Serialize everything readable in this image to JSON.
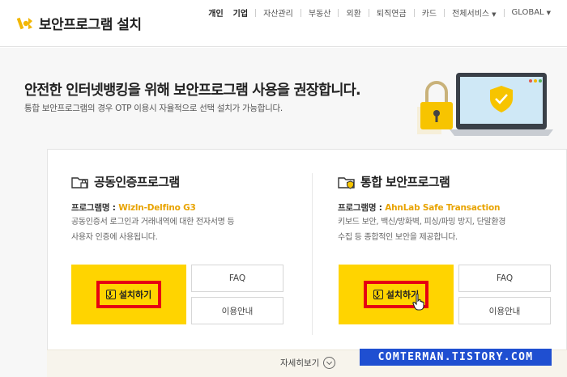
{
  "header": {
    "title": "보안프로그램 설치",
    "nav": [
      {
        "label": "개인",
        "bold": true
      },
      {
        "label": "기업",
        "bold": true
      },
      {
        "label": "자산관리"
      },
      {
        "label": "부동산"
      },
      {
        "label": "외환"
      },
      {
        "label": "퇴직연금"
      },
      {
        "label": "카드"
      },
      {
        "label": "전체서비스"
      },
      {
        "label": "GLOBAL"
      }
    ]
  },
  "hero": {
    "title": "안전한 인터넷뱅킹을 위해 보안프로그램 사용을 권장합니다.",
    "subtitle": "통합 보안프로그램의 경우 OTP 이용시 자율적으로 선택 설치가 가능합니다."
  },
  "left": {
    "title": "공동인증프로그램",
    "prog_label": "프로그램명 : ",
    "prog_name": "Wizln-Delfino G3",
    "desc1": "공동인증서 로그인과 거래내역에 대한 전자서명 등",
    "desc2": "사용자 인증에 사용됩니다.",
    "install": "설치하기",
    "faq": "FAQ",
    "guide": "이용안내"
  },
  "right": {
    "title": "통합 보안프로그램",
    "prog_label": "프로그램명 : ",
    "prog_name": "AhnLab Safe Transaction",
    "desc1": "키보드 보안, 백신/방화벽, 피싱/파밍 방지, 단말환경",
    "desc2": "수집 등 종합적인 보안을 제공합니다.",
    "install": "설치하기",
    "faq": "FAQ",
    "guide": "이용안내"
  },
  "more": "자세히보기",
  "watermark": "COMTERMAN.TISTORY.COM",
  "colors": {
    "accent": "#ffd400",
    "highlight": "#e60012",
    "program_name": "#e8a300",
    "watermark_bg": "#1f4fd1"
  }
}
